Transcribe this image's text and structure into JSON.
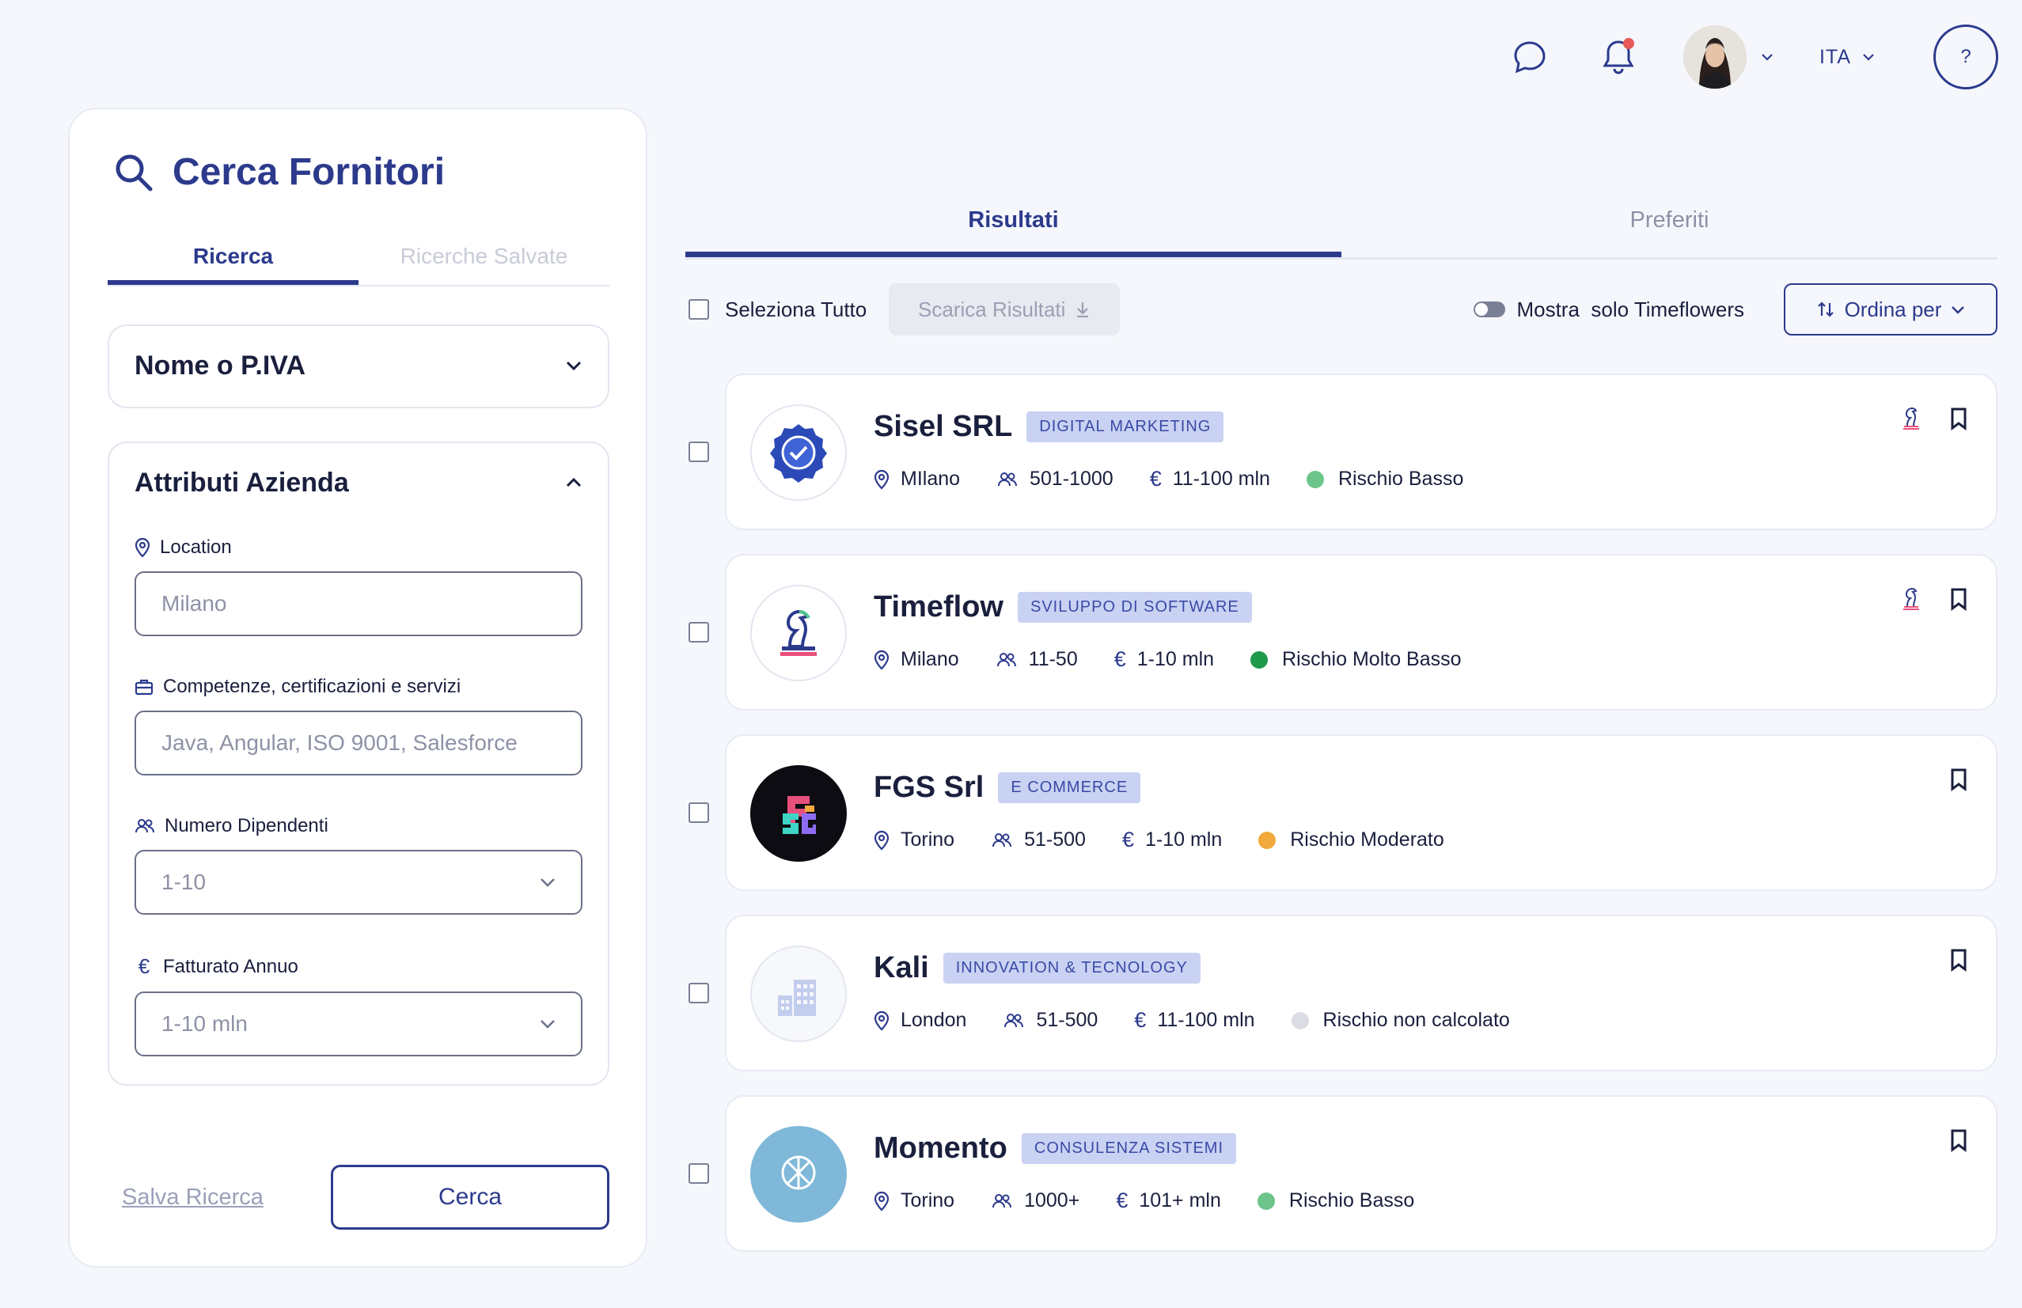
{
  "header": {
    "language": "ITA",
    "help_label": "?"
  },
  "search_panel": {
    "title": "Cerca Fornitori",
    "tabs": [
      {
        "label": "Ricerca",
        "active": true
      },
      {
        "label": "Ricerche Salvate",
        "active": false
      }
    ],
    "name_section": {
      "label": "Nome o P.IVA",
      "expanded": false
    },
    "attributes_section": {
      "label": "Attributi Azienda",
      "expanded": true,
      "fields": {
        "location": {
          "label": "Location",
          "placeholder": "Milano"
        },
        "skills": {
          "label": "Competenze, certificazioni e servizi",
          "placeholder": "Java, Angular, ISO 9001, Salesforce"
        },
        "employees": {
          "label": "Numero Dipendenti",
          "value": "1-10"
        },
        "revenue": {
          "label": "Fatturato Annuo",
          "value": "1-10 mln"
        }
      }
    },
    "save_search_label": "Salva Ricerca",
    "search_button_label": "Cerca"
  },
  "results": {
    "tabs": [
      {
        "label": "Risultati",
        "active": true
      },
      {
        "label": "Preferiti",
        "active": false
      }
    ],
    "select_all_label": "Seleziona Tutto",
    "download_label": "Scarica Risultati",
    "toggle_label": "Mostra  solo Timeflowers",
    "sort_label": "Ordina per",
    "companies": [
      {
        "name": "Sisel SRL",
        "category": "DIGITAL MARKETING",
        "city": "MIlano",
        "employees": "501-1000",
        "revenue": "11-100 mln",
        "risk": "Rischio Basso",
        "risk_color": "#6cc489",
        "timeflow_member": true,
        "logo": "badge-check-icon"
      },
      {
        "name": "Timeflow",
        "category": "SVILUPPO DI SOFTWARE",
        "city": "Milano",
        "employees": "11-50",
        "revenue": "1-10 mln",
        "risk": "Rischio Molto Basso",
        "risk_color": "#1e9a4a",
        "timeflow_member": true,
        "logo": "chess-knight-icon"
      },
      {
        "name": "FGS Srl",
        "category": "E COMMERCE",
        "city": "Torino",
        "employees": "51-500",
        "revenue": "1-10 mln",
        "risk": "Rischio Moderato",
        "risk_color": "#f2a93b",
        "timeflow_member": false,
        "logo": "fgs-logo"
      },
      {
        "name": "Kali",
        "category": "INNOVATION & TECNOLOGY",
        "city": "London",
        "employees": "51-500",
        "revenue": "11-100 mln",
        "risk": "Rischio non calcolato",
        "risk_color": "#dcdde2",
        "timeflow_member": false,
        "logo": "building-icon"
      },
      {
        "name": "Momento",
        "category": "CONSULENZA SISTEMI",
        "city": "Torino",
        "employees": "1000+",
        "revenue": "101+ mln",
        "risk": "Rischio Basso",
        "risk_color": "#6cc489",
        "timeflow_member": false,
        "logo": "momento-logo"
      }
    ]
  }
}
